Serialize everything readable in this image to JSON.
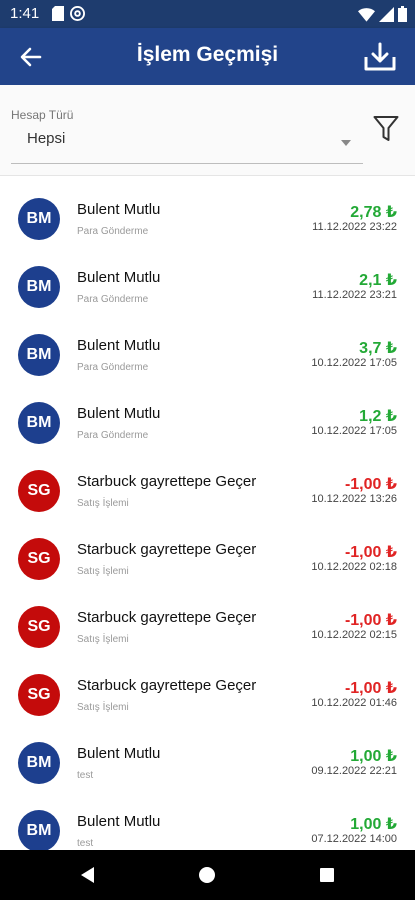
{
  "status_bar": {
    "time": "1:41"
  },
  "app_bar": {
    "title": "İşlem Geçmişi"
  },
  "filter": {
    "label": "Hesap Türü",
    "selected": "Hepsi"
  },
  "colors": {
    "primary": "#22448a",
    "status_bar": "#1e3c6e",
    "positive": "#23a936",
    "negative": "#e02424",
    "avatar_bm": "#1d3f8e",
    "avatar_sg": "#c40b0b"
  },
  "transactions": [
    {
      "initials": "BM",
      "name": "Bulent Mutlu",
      "type": "Para Gönderme",
      "amount": "2,78 ₺",
      "date": "11.12.2022 23:22"
    },
    {
      "initials": "BM",
      "name": "Bulent Mutlu",
      "type": "Para Gönderme",
      "amount": "2,1 ₺",
      "date": "11.12.2022 23:21"
    },
    {
      "initials": "BM",
      "name": "Bulent Mutlu",
      "type": "Para Gönderme",
      "amount": "3,7 ₺",
      "date": "10.12.2022 17:05"
    },
    {
      "initials": "BM",
      "name": "Bulent Mutlu",
      "type": "Para Gönderme",
      "amount": "1,2 ₺",
      "date": "10.12.2022 17:05"
    },
    {
      "initials": "SG",
      "name": "Starbuck gayrettepe Geçer",
      "type": "Satış İşlemi",
      "amount": "-1,00 ₺",
      "date": "10.12.2022 13:26"
    },
    {
      "initials": "SG",
      "name": "Starbuck gayrettepe Geçer",
      "type": "Satış İşlemi",
      "amount": "-1,00 ₺",
      "date": "10.12.2022 02:18"
    },
    {
      "initials": "SG",
      "name": "Starbuck gayrettepe Geçer",
      "type": "Satış İşlemi",
      "amount": "-1,00 ₺",
      "date": "10.12.2022 02:15"
    },
    {
      "initials": "SG",
      "name": "Starbuck gayrettepe Geçer",
      "type": "Satış İşlemi",
      "amount": "-1,00 ₺",
      "date": "10.12.2022 01:46"
    },
    {
      "initials": "BM",
      "name": "Bulent Mutlu",
      "type": "test",
      "amount": "1,00 ₺",
      "date": "09.12.2022 22:21"
    },
    {
      "initials": "BM",
      "name": "Bulent Mutlu",
      "type": "test",
      "amount": "1,00 ₺",
      "date": "07.12.2022 14:00"
    }
  ]
}
